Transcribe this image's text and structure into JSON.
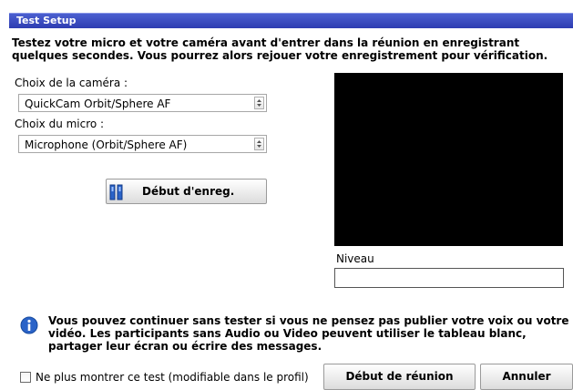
{
  "window": {
    "title": "Test Setup"
  },
  "intro": "Testez votre micro et votre caméra avant d'entrer dans la réunion en enregistrant quelques secondes. Vous pourrez alors rejouer votre enregistrement pour vérification.",
  "camera": {
    "label": "Choix de la caméra :",
    "value": "QuickCam Orbit/Sphere AF"
  },
  "micro": {
    "label": "Choix du micro :",
    "value": "Microphone (Orbit/Sphere AF)"
  },
  "record_button": {
    "label": "Début d'enreg.",
    "icon": "pause-icon"
  },
  "level": {
    "label": "Niveau"
  },
  "info": {
    "icon": "info-icon",
    "text": "Vous pouvez continuer sans tester si vous ne pensez pas publier votre voix ou votre vidéo. Les participants sans Audio ou Video peuvent utiliser le tableau blanc, partager leur écran ou écrire des messages."
  },
  "dont_show": {
    "label": "Ne plus montrer ce test (modifiable dans le profil)",
    "checked": false
  },
  "buttons": {
    "start_meeting": "Début de réunion",
    "cancel": "Annuler"
  },
  "colors": {
    "titlebar": "#2e3db2",
    "video_bg": "#000000",
    "icon_blue": "#2a63c8"
  }
}
